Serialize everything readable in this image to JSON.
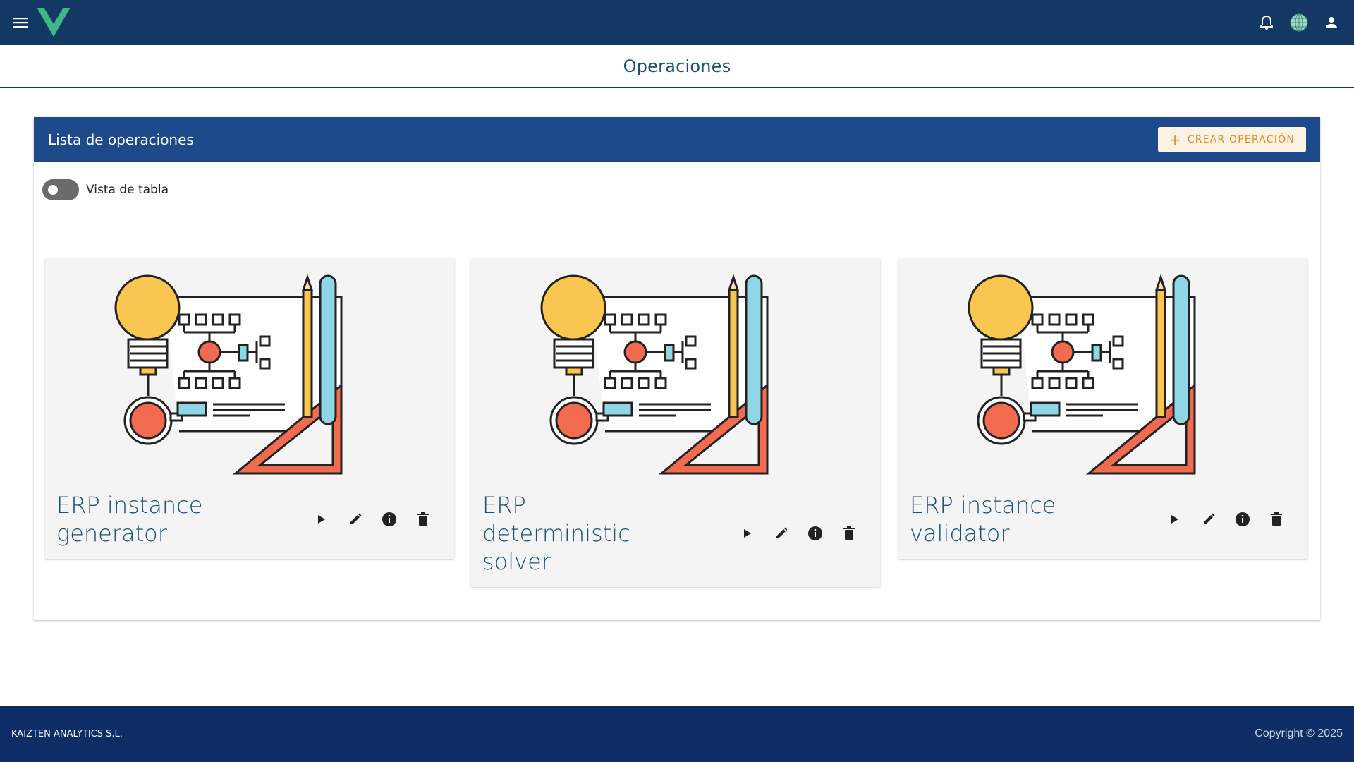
{
  "appbar": {
    "menu_icon": "menu-icon",
    "logo": "vue-logo",
    "right_icons": [
      "bell-icon",
      "globe-icon",
      "account-icon"
    ]
  },
  "page": {
    "title": "Operaciones"
  },
  "panel": {
    "title": "Lista de operaciones",
    "create_button": "CREAR OPERACIÓN",
    "toggle_label": "Vista de tabla",
    "toggle_on": false
  },
  "operations": [
    {
      "name_lines": [
        "ERP instance",
        "generator"
      ]
    },
    {
      "name_lines": [
        "ERP",
        "deterministic",
        "solver"
      ]
    },
    {
      "name_lines": [
        "ERP instance",
        "validator"
      ]
    }
  ],
  "action_icons": [
    "play-icon",
    "pencil-icon",
    "info-icon",
    "trash-icon"
  ],
  "footer": {
    "company": "KAIZTEN ANALYTICS S.L.",
    "copyright": "Copyright © 2025"
  },
  "colors": {
    "appbar": "#123863",
    "panel_header": "#1c4a8a",
    "footer": "#0e2c66",
    "accent_orange": "#e88a1c",
    "title_blue": "#1a4f7a"
  }
}
